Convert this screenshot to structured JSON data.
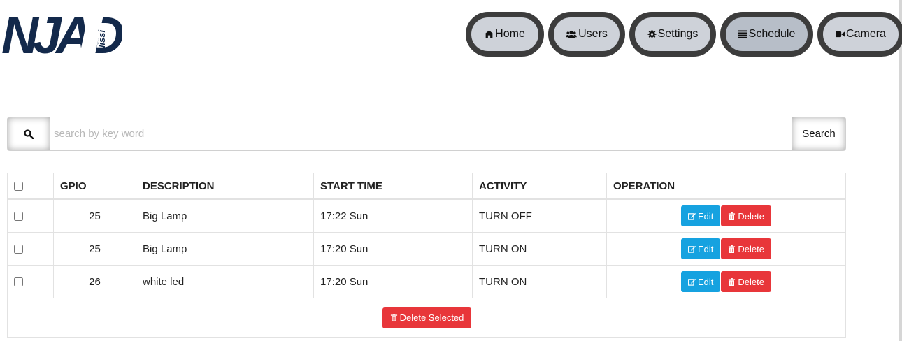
{
  "brand": {
    "logo_text": "NJAD",
    "logo_sub": "Nissi"
  },
  "nav": {
    "home": "Home",
    "users": "Users",
    "settings": "Settings",
    "schedule": "Schedule",
    "camera": "Camera",
    "active": "schedule"
  },
  "search": {
    "placeholder": "search by key word",
    "value": "",
    "button": "Search"
  },
  "table": {
    "headers": {
      "gpio": "GPIO",
      "description": "DESCRIPTION",
      "start_time": "START TIME",
      "activity": "ACTIVITY",
      "operation": "OPERATION"
    },
    "rows": [
      {
        "gpio": "25",
        "description": "Big Lamp",
        "start_time": "17:22 Sun",
        "activity": "TURN OFF",
        "checked": false
      },
      {
        "gpio": "25",
        "description": "Big Lamp",
        "start_time": "17:20 Sun",
        "activity": "TURN ON",
        "checked": false
      },
      {
        "gpio": "26",
        "description": "white led",
        "start_time": "17:20 Sun",
        "activity": "TURN ON",
        "checked": false
      }
    ],
    "edit_label": "Edit",
    "delete_label": "Delete",
    "delete_selected_label": "Delete Selected"
  },
  "colors": {
    "edit": "#16a2e0",
    "delete": "#e8363a",
    "logo": "#13294b",
    "nav_border": "#3c3c3c",
    "nav_bg": "#ced2d9"
  },
  "icons": {
    "home": "home-icon",
    "users": "users-icon",
    "settings": "gear-icon",
    "schedule": "list-icon",
    "camera": "video-camera-icon",
    "search": "search-icon",
    "edit": "edit-icon",
    "delete": "trash-icon"
  }
}
